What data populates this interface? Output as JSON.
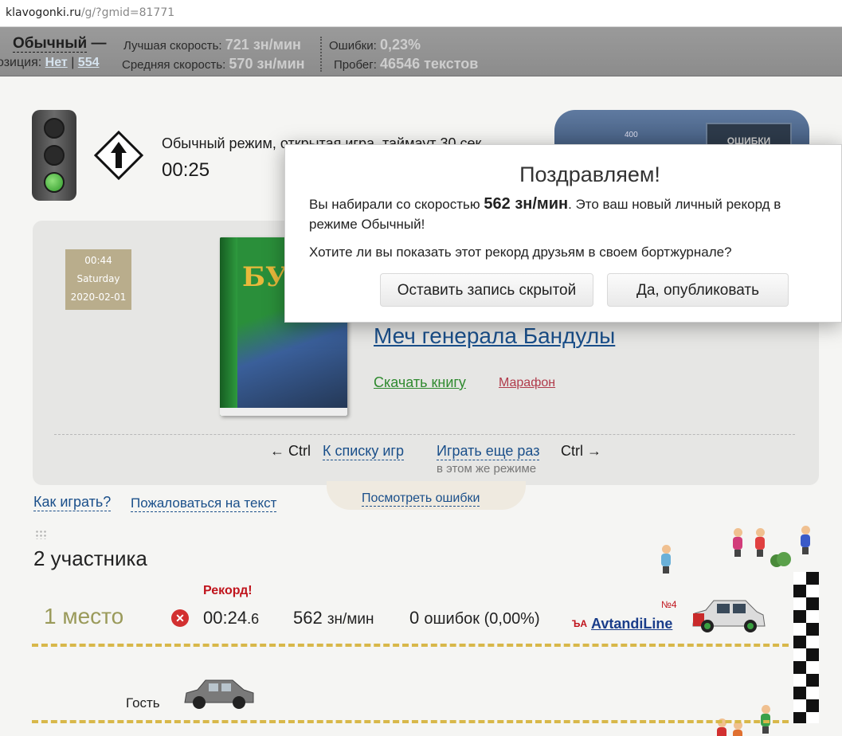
{
  "browser": {
    "url_host": "klavogonki.ru",
    "url_path": "/g/?gmid=81771"
  },
  "stats": {
    "mode_name": "Обычный",
    "mode_dash": "—",
    "position_label": "озиция:",
    "position_no": "Нет",
    "position_sep": "|",
    "position_num": "554",
    "best_speed_label": "Лучшая скорость:",
    "best_speed_value": "721 зн/мин",
    "avg_speed_label": "Средняя скорость:",
    "avg_speed_value": "570 зн/мин",
    "errors_label": "Ошибки:",
    "errors_value": "0,23%",
    "mileage_label": "Пробег:",
    "mileage_value": "46546 текстов"
  },
  "game": {
    "description": "Обычный режим, открытая игра, таймаут 30 сек.",
    "timer": "00:25",
    "speedometer_tick": "400",
    "errors_panel": "ОШИБКИ"
  },
  "date_box": {
    "time": "00:44",
    "weekday": "Saturday",
    "date": "2020-02-01"
  },
  "book": {
    "cover_title": "БУЛЫ",
    "title": "Меч генерала Бандулы",
    "download": "Скачать книгу",
    "marathon": "Марафон"
  },
  "navigation": {
    "prev_key": "← Ctrl",
    "games_list": "К списку игр",
    "play_again": "Играть еще раз",
    "next_key": "Ctrl →",
    "same_mode": "в этом же режиме"
  },
  "help": {
    "how_to_play": "Как играть?",
    "complain": "Пожаловаться на текст",
    "view_errors": "Посмотреть ошибки"
  },
  "race": {
    "participants": "2 участника",
    "record_label": "Рекорд!",
    "place": "1 место",
    "time_main": "00:24",
    "time_frac": ".6",
    "speed_value": "562",
    "speed_unit": "зн/мин",
    "errors_count": "0",
    "errors_text": "ошибок (0,00%)",
    "rank_badge": "№4",
    "player_name": "AvtandiLine",
    "guest_label": "Гость"
  },
  "modal": {
    "title": "Поздравляем!",
    "msg_prefix": "Вы набирали со скоростью",
    "msg_speed": "562 зн/мин",
    "msg_suffix": ". Это ваш новый личный рекорд в режиме Обычный!",
    "question": "Хотите ли вы показать этот рекорд друзьям в своем бортжурнале?",
    "keep_hidden_button": "Оставить запись скрытой",
    "publish_button": "Да, опубликовать"
  },
  "colors": {
    "link": "#1a4f8a",
    "record": "#c0141c",
    "lane": "#d8b84a"
  }
}
